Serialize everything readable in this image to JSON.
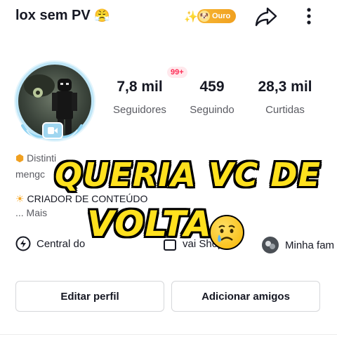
{
  "header": {
    "username": "lox sem PV",
    "username_emoji": "😤",
    "sparkle": "✨",
    "badge_label": "Ouro",
    "badge_coin": "🐶"
  },
  "stats": {
    "notification_badge": "99+",
    "followers_value": "7,8 mil",
    "followers_label": "Seguidores",
    "following_value": "459",
    "following_label": "Seguindo",
    "likes_value": "28,3 mil",
    "likes_label": "Curtidas"
  },
  "bio": {
    "line1": "Distinti",
    "line2": "mengc",
    "line3": "CRIADOR DE CONTEÚDO",
    "more": "...  Mais"
  },
  "links": {
    "central": "Central do",
    "shop": "vai Shop",
    "family": "Minha fam"
  },
  "overlay": {
    "line1": "QUERIA VC DE",
    "line2": "VOLTA"
  },
  "buttons": {
    "edit_profile": "Editar perfil",
    "add_friends": "Adicionar amigos"
  },
  "colors": {
    "caption_fill": "#ffe11e",
    "caption_outline": "#000000",
    "accent_red": "#fe2c55",
    "gold": "#f0a020"
  }
}
